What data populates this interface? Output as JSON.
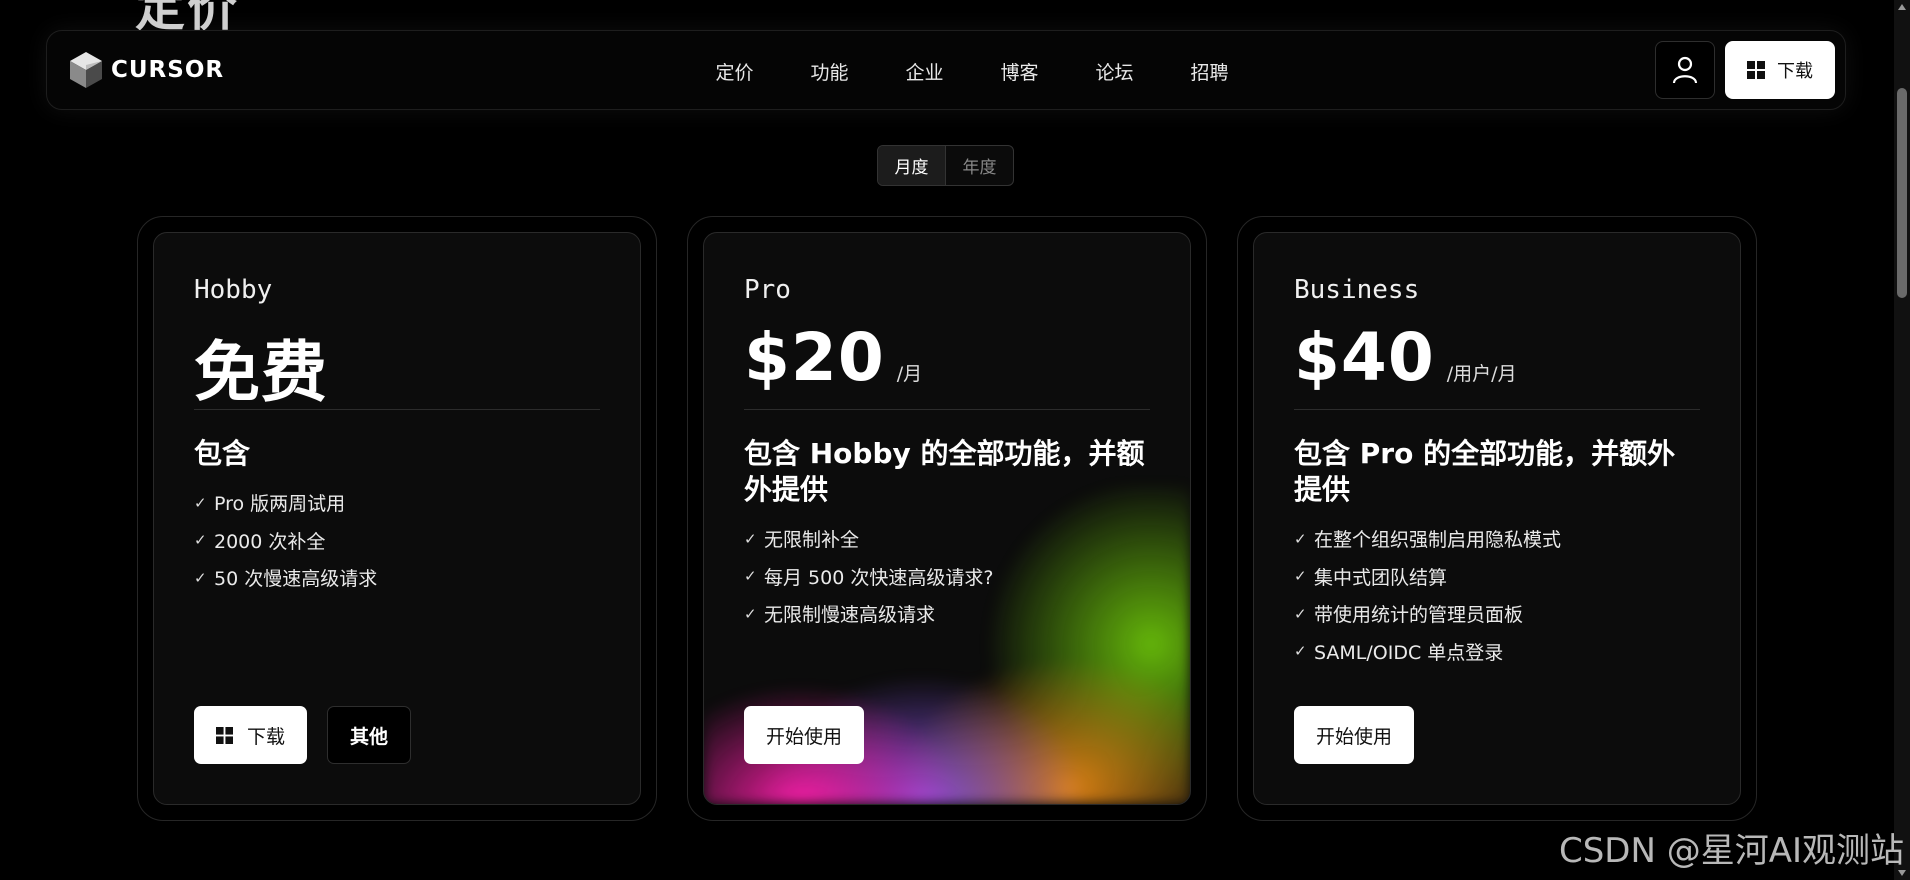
{
  "page": {
    "bg_title": "定价"
  },
  "nav": {
    "logo_text": "CURSOR",
    "links": [
      "定价",
      "功能",
      "企业",
      "博客",
      "论坛",
      "招聘"
    ],
    "download_label": "下载"
  },
  "billing_toggle": {
    "monthly": "月度",
    "yearly": "年度",
    "selected": "月度"
  },
  "plans": [
    {
      "name": "Hobby",
      "price": "免费",
      "unit": "",
      "includes_title": "包含",
      "features": [
        "Pro 版两周试用",
        "2000 次补全",
        "50 次慢速高级请求"
      ],
      "buttons": {
        "download": "下载",
        "other": "其他"
      }
    },
    {
      "name": "Pro",
      "price": "$20",
      "unit": "/月",
      "includes_title": "包含 Hobby 的全部功能，并额外提供",
      "features": [
        "无限制补全",
        "每月 500 次快速高级请求?",
        "无限制慢速高级请求"
      ],
      "buttons": {
        "start": "开始使用"
      }
    },
    {
      "name": "Business",
      "price": "$40",
      "unit": "/用户/月",
      "includes_title": "包含 Pro 的全部功能，并额外提供",
      "features": [
        "在整个组织强制启用隐私模式",
        "集中式团队结算",
        "带使用统计的管理员面板",
        "SAML/OIDC 单点登录"
      ],
      "buttons": {
        "start": "开始使用"
      }
    }
  ],
  "icons": {
    "logo": "cube-logo-icon",
    "user": "user-icon",
    "windows": "windows-icon",
    "check": "check-icon"
  },
  "watermark": "CSDN @星河AI观测站"
}
